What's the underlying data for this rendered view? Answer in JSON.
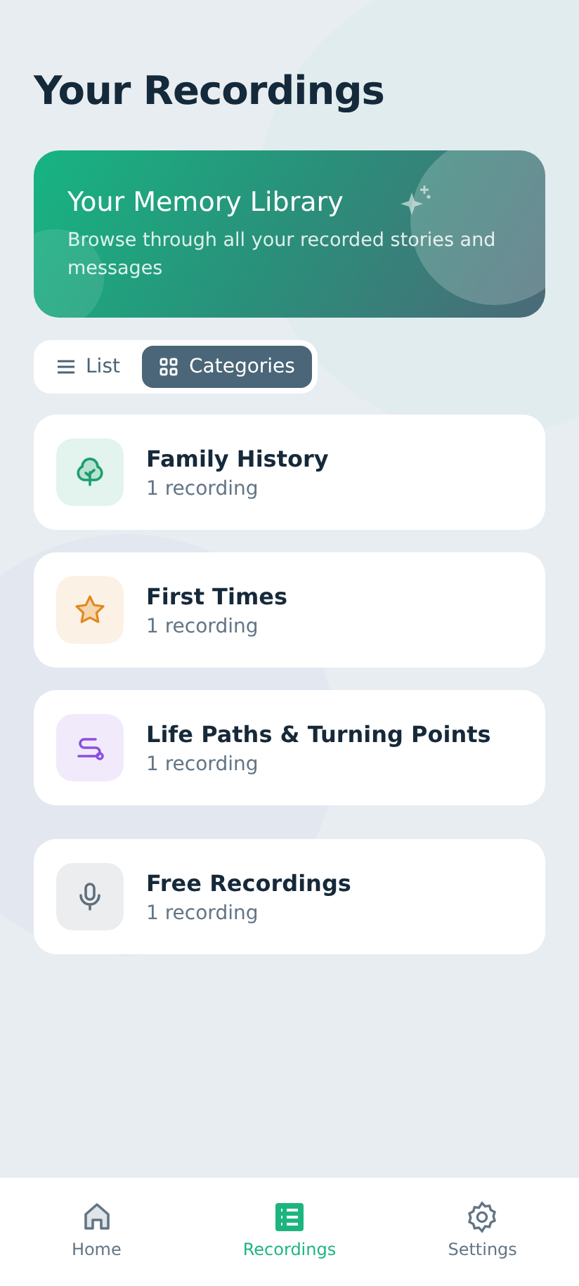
{
  "title": "Your Recordings",
  "banner": {
    "title": "Your Memory Library",
    "subtitle": "Browse through all your recorded stories and messages"
  },
  "view_toggle": [
    {
      "label": "List",
      "kind": "list",
      "selected": false
    },
    {
      "label": "Categories",
      "kind": "grid",
      "selected": true
    }
  ],
  "categories": [
    {
      "name": "Family History",
      "count": "1 recording",
      "kind": "tree",
      "color": "#1a9e6e"
    },
    {
      "name": "First Times",
      "count": "1 recording",
      "kind": "star",
      "color": "#e08a1e"
    },
    {
      "name": "Life Paths & Turning Points",
      "count": "1 recording",
      "kind": "path",
      "color": "#8b4fe0"
    },
    {
      "name": "Free Recordings",
      "count": "1 recording",
      "kind": "mic",
      "color": "#5f6f7c"
    }
  ],
  "bottom_nav": [
    {
      "label": "Home",
      "kind": "home",
      "selected": false
    },
    {
      "label": "Recordings",
      "kind": "recordings",
      "selected": true
    },
    {
      "label": "Settings",
      "kind": "settings",
      "selected": false
    }
  ]
}
